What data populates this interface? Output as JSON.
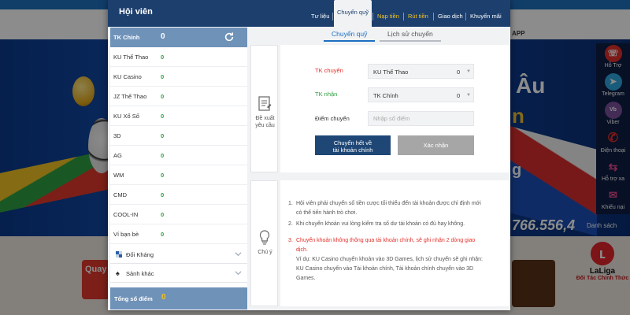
{
  "background": {
    "header_app": "APP",
    "hero_title": "Âu",
    "hero_line2": "n",
    "hero_line3": "g",
    "jackpot": "766.556,4",
    "jackpot_link": "Danh sách",
    "promo_badge": "Quay",
    "partner_name": "LaLiga",
    "partner_caption": "Đối Tác Chính Thức",
    "side_items": [
      {
        "label": "Hỗ Trợ",
        "icon": "headset-icon",
        "color": "#e2312b"
      },
      {
        "label": "Telegram",
        "icon": "telegram-icon",
        "color": "#2ea6de"
      },
      {
        "label": "Viber",
        "icon": "viber-icon",
        "color": "#7b519d"
      },
      {
        "label": "Điện thoại",
        "icon": "phone-icon",
        "color": "#e2312b"
      },
      {
        "label": "Hỗ trợ xa",
        "icon": "remote-support-icon",
        "color": "#e24a8f"
      },
      {
        "label": "Khiếu nại",
        "icon": "complaint-icon",
        "color": "#e24a8f"
      }
    ]
  },
  "modal": {
    "title": "Hội viên",
    "nav": [
      "Tư liệu",
      "Chuyển quỹ",
      "Nạp tiền",
      "Rút tiền",
      "Giao dịch",
      "Khuyến mãi"
    ],
    "active_nav": "Chuyển quỹ",
    "highlight_nav": [
      "Nạp tiền",
      "Rút tiền"
    ],
    "wallets": [
      {
        "name": "TK Chính",
        "value": "0"
      },
      {
        "name": "KU Thể Thao",
        "value": "0"
      },
      {
        "name": "KU Casino",
        "value": "0"
      },
      {
        "name": "JZ Thể Thao",
        "value": "0"
      },
      {
        "name": "KU Xổ Số",
        "value": "0"
      },
      {
        "name": "3D",
        "value": "0"
      },
      {
        "name": "AG",
        "value": "0"
      },
      {
        "name": "WM",
        "value": "0"
      },
      {
        "name": "CMD",
        "value": "0"
      },
      {
        "name": "COOL-IN",
        "value": "0"
      },
      {
        "name": "Ví bạn bè",
        "value": "0"
      }
    ],
    "groups": [
      {
        "label": "Đối Kháng",
        "icon": "versus-icon"
      },
      {
        "label": "Sảnh khác",
        "icon": "spade-icon"
      }
    ],
    "total": {
      "label": "Tổng số điểm",
      "value": "0"
    },
    "tabs": [
      "Chuyển quỹ",
      "Lịch sử chuyển"
    ],
    "proposal_label": "Đề xuất yêu cầu",
    "form": {
      "from_label": "TK chuyển",
      "from_value": "KU Thể Thao",
      "from_amount": "0",
      "to_label": "TK nhận",
      "to_value": "TK Chính",
      "to_amount": "0",
      "points_label": "Điểm chuyển",
      "points_placeholder": "Nhập số điểm",
      "transfer_all_line1": "Chuyển hết về",
      "transfer_all_line2": "tài khoản chính",
      "confirm": "Xác nhận",
      "from_label_color": "#e2312b",
      "to_label_color": "#2e9d3f"
    },
    "note_label": "Chú ý",
    "notes": [
      "Hội viên phải chuyển số tiền cược tối thiểu đến tài khoản được chỉ định mới có thể tiến hành trò chơi.",
      "Khi chuyển khoản vui lòng kiểm tra số dư tài khoản có đủ hay không.",
      "Chuyển khoản không thông qua tài khoản chính, sẽ ghi nhận 2 dòng giao dịch.",
      "Ví dụ: KU Casino chuyển khoản vào 3D Games, lịch sử chuyển sẽ ghi nhận: KU Casino chuyển vào Tài khoản chính, Tài khoản chính chuyển vào 3D Games."
    ]
  }
}
